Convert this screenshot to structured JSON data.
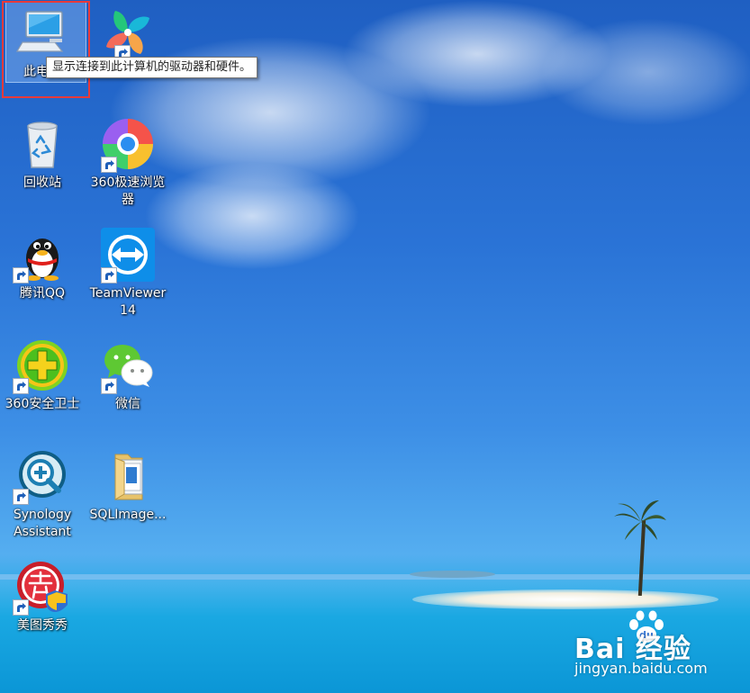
{
  "desktop": {
    "icons": [
      {
        "label": "此电脑",
        "shortcut": false
      },
      {
        "label": "",
        "shortcut": true
      },
      {
        "label": "回收站",
        "shortcut": false
      },
      {
        "label": "360极速浏览\n器",
        "shortcut": true
      },
      {
        "label": "腾讯QQ",
        "shortcut": true
      },
      {
        "label": "TeamViewer\n14",
        "shortcut": true
      },
      {
        "label": "360安全卫士",
        "shortcut": true
      },
      {
        "label": "微信",
        "shortcut": true
      },
      {
        "label": "Synology\nAssistant",
        "shortcut": true
      },
      {
        "label": "SQLImage...",
        "shortcut": false
      },
      {
        "label": "美图秀秀",
        "shortcut": true
      }
    ]
  },
  "tooltip": {
    "text": "显示连接到此计算机的驱动器和硬件。"
  },
  "watermark": {
    "brand": "Bai  经验",
    "url": "jingyan.baidu.com"
  },
  "colors": {
    "highlight_box": "#e83a3a",
    "label_text": "#ffffff"
  }
}
